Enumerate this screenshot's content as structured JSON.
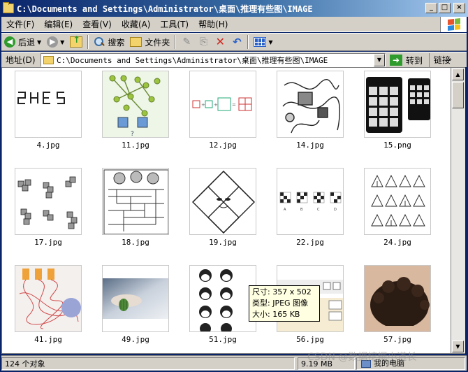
{
  "window": {
    "title": "C:\\Documents and Settings\\Administrator\\桌面\\推理有些图\\IMAGE",
    "controls": [
      "_",
      "□",
      "×"
    ]
  },
  "menu": [
    "文件(F)",
    "编辑(E)",
    "查看(V)",
    "收藏(A)",
    "工具(T)",
    "帮助(H)"
  ],
  "toolbar": {
    "back_label": "后退",
    "search_label": "搜索",
    "folders_label": "文件夹"
  },
  "address": {
    "label": "地址(D)",
    "path": "C:\\Documents and Settings\\Administrator\\桌面\\推理有些图\\IMAGE",
    "go_label": "转到",
    "links_label": "链接"
  },
  "files": [
    {
      "name": "4.jpg",
      "thumb": "2HES"
    },
    {
      "name": "11.jpg",
      "thumb": "circuit-diagram"
    },
    {
      "name": "12.jpg",
      "thumb": "square-equation"
    },
    {
      "name": "14.jpg",
      "thumb": "scribble-puzzle"
    },
    {
      "name": "15.png",
      "thumb": "keypad-phones"
    },
    {
      "name": "17.jpg",
      "thumb": "cube-shapes"
    },
    {
      "name": "18.jpg",
      "thumb": "maze-cartoon"
    },
    {
      "name": "19.jpg",
      "thumb": "diamond-face"
    },
    {
      "name": "22.jpg",
      "thumb": "checker-sequence"
    },
    {
      "name": "24.jpg",
      "thumb": "triangle-grid"
    },
    {
      "name": "41.jpg",
      "thumb": "tangled-lines"
    },
    {
      "name": "49.jpg",
      "thumb": "photo-bed"
    },
    {
      "name": "51.jpg",
      "thumb": "monkey-faces"
    },
    {
      "name": "56.jpg",
      "thumb": "toolbar-icons"
    },
    {
      "name": "57.jpg",
      "thumb": "photo-hair"
    }
  ],
  "tooltip": {
    "size": "尺寸: 357 x 502",
    "type": "类型: JPEG 图像",
    "filesize": "大小: 165 KB"
  },
  "status": {
    "count": "124 个对象",
    "size": "9.19 MB",
    "zone": "我的电脑"
  },
  "watermark": "CSDN @数据挖掘小道长"
}
